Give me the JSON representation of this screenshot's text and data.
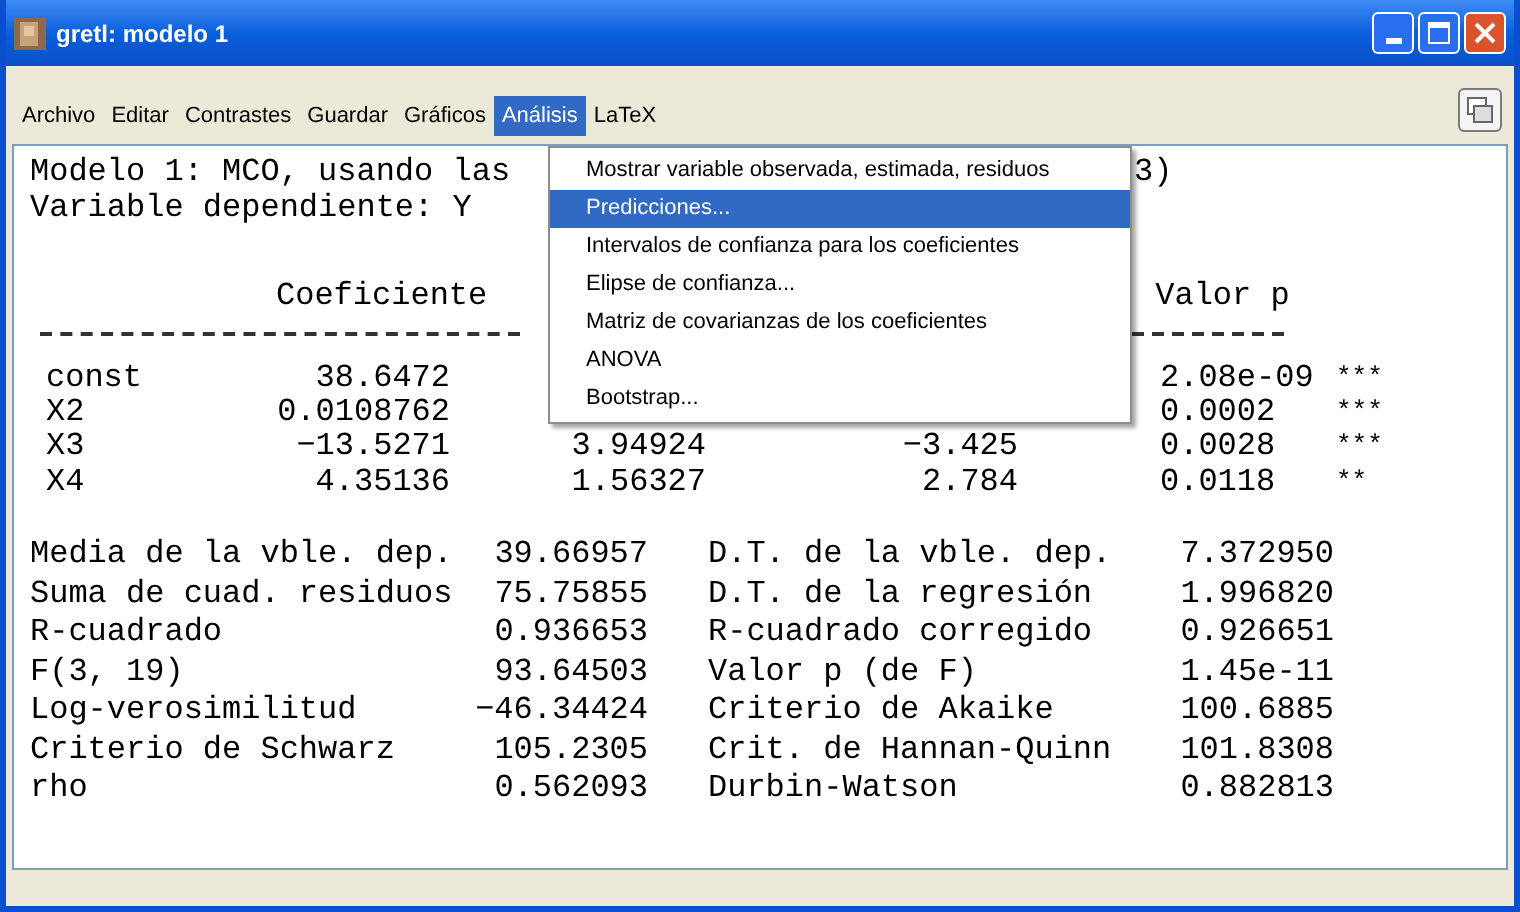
{
  "window": {
    "title": "gretl: modelo 1"
  },
  "menu_bar": [
    {
      "label": "Archivo",
      "selected": false
    },
    {
      "label": "Editar",
      "selected": false
    },
    {
      "label": "Contrastes",
      "selected": false
    },
    {
      "label": "Guardar",
      "selected": false
    },
    {
      "label": "Gráficos",
      "selected": false
    },
    {
      "label": "Análisis",
      "selected": true
    },
    {
      "label": "LaTeX",
      "selected": false
    }
  ],
  "dropdown_menu": [
    {
      "label": "Mostrar variable observada, estimada, residuos",
      "selected": false
    },
    {
      "label": "Predicciones...",
      "selected": true
    },
    {
      "label": "Intervalos de confianza para los coeficientes",
      "selected": false
    },
    {
      "label": "Elipse de confianza...",
      "selected": false
    },
    {
      "label": "Matriz de covarianzas de los coeficientes",
      "selected": false
    },
    {
      "label": "ANOVA",
      "selected": false
    },
    {
      "label": "Bootstrap...",
      "selected": false
    }
  ],
  "output": {
    "title_line": "Modelo 1: MCO, usando las",
    "title_line_tail": "3)",
    "dependent_line": "Variable dependiente: Y",
    "table": {
      "columns": {
        "coefficient": "Coeficiente",
        "p_value": "Valor p"
      },
      "rows": [
        {
          "name": "const",
          "coefficient": "38.6472",
          "p_value": "2.08e-09",
          "stars": "***"
        },
        {
          "name": "X2",
          "coefficient": "0.0108762",
          "p_value": "0.0002",
          "stars": "***"
        },
        {
          "name": "X3",
          "coefficient": "−13.5271",
          "std_error": "3.94924",
          "t_ratio": "−3.425",
          "p_value": "0.0028",
          "stars": "***"
        },
        {
          "name": "X4",
          "coefficient": "4.35136",
          "std_error": "1.56327",
          "t_ratio": "2.784",
          "p_value": "0.0118",
          "stars": "**"
        }
      ]
    },
    "statistics": [
      {
        "label": "Media de la vble. dep.",
        "value": "39.66957",
        "label_2": "D.T. de la vble. dep.",
        "value_2": "7.372950"
      },
      {
        "label": "Suma de cuad. residuos",
        "value": "75.75855",
        "label_2": "D.T. de la regresión",
        "value_2": "1.996820"
      },
      {
        "label": "R-cuadrado",
        "value": "0.936653",
        "label_2": "R-cuadrado corregido",
        "value_2": "0.926651"
      },
      {
        "label": "F(3, 19)",
        "value": "93.64503",
        "label_2": "Valor p (de F)",
        "value_2": "1.45e-11"
      },
      {
        "label": "Log-verosimilitud",
        "value": "−46.34424",
        "label_2": "Criterio de Akaike",
        "value_2": "100.6885"
      },
      {
        "label": "Criterio de Schwarz",
        "value": "105.2305",
        "label_2": "Crit. de Hannan-Quinn",
        "value_2": "101.8308"
      },
      {
        "label": "rho",
        "value": "0.562093",
        "label_2": "Durbin-Watson",
        "value_2": "0.882813"
      }
    ]
  }
}
